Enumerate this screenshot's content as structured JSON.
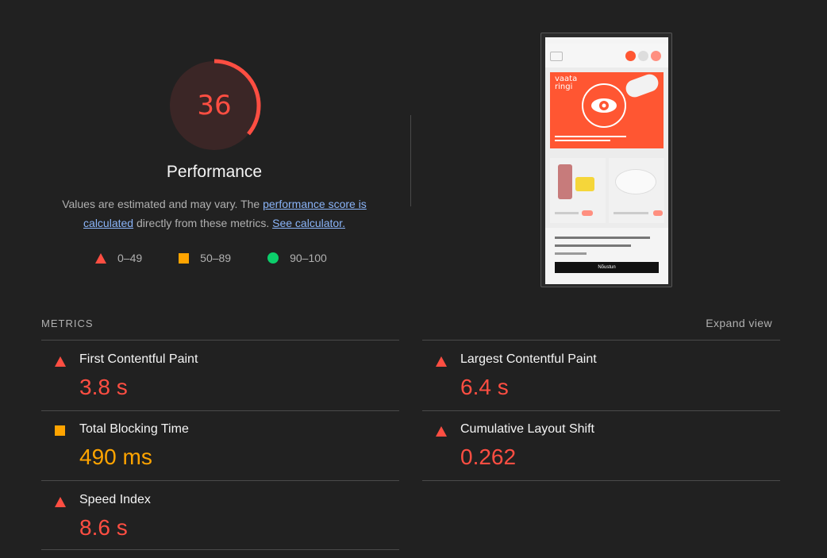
{
  "gauge": {
    "score": "36",
    "color": "#ff4e42"
  },
  "performance": {
    "title": "Performance",
    "desc_prefix": "Values are estimated and may vary. The ",
    "link_score": "performance score is calculated",
    "desc_middle": " directly from these metrics. ",
    "link_calculator": "See calculator."
  },
  "legend": [
    {
      "icon": "triangle",
      "label": "0–49",
      "color": "#ff4e42"
    },
    {
      "icon": "square",
      "label": "50–89",
      "color": "#ffa400"
    },
    {
      "icon": "circle",
      "label": "90–100",
      "color": "#0cce6b"
    }
  ],
  "screenshot": {
    "hero_title_line1": "vaata",
    "hero_title_line2": "ringi",
    "cookie_button": "Nõustun"
  },
  "metrics_section": {
    "label": "METRICS",
    "expand": "Expand view"
  },
  "metrics": [
    {
      "name": "First Contentful Paint",
      "value": "3.8 s",
      "rating": "fail"
    },
    {
      "name": "Largest Contentful Paint",
      "value": "6.4 s",
      "rating": "fail"
    },
    {
      "name": "Total Blocking Time",
      "value": "490 ms",
      "rating": "average"
    },
    {
      "name": "Cumulative Layout Shift",
      "value": "0.262",
      "rating": "fail"
    },
    {
      "name": "Speed Index",
      "value": "8.6 s",
      "rating": "fail"
    }
  ]
}
